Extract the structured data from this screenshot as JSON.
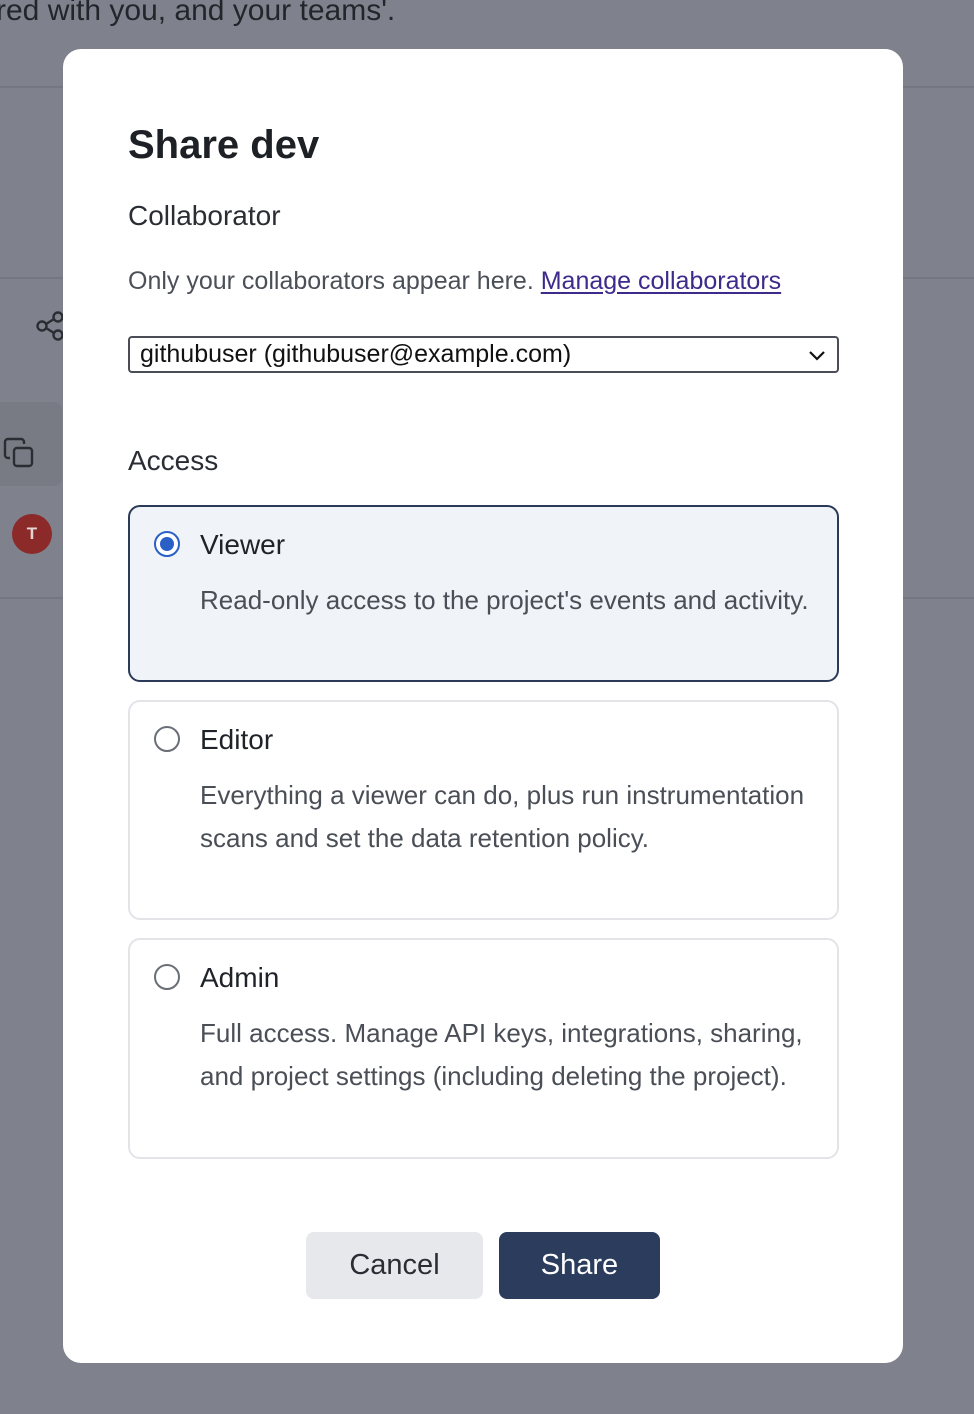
{
  "background": {
    "text": "red with you, and your teams'.",
    "avatar_initial": "T"
  },
  "modal": {
    "title": "Share dev",
    "collaborator_label": "Collaborator",
    "help_text": "Only your collaborators appear here. ",
    "manage_link": "Manage collaborators",
    "select_value": "githubuser (githubuser@example.com)",
    "access_label": "Access",
    "options": [
      {
        "title": "Viewer",
        "description": "Read-only access to the project's events and activity.",
        "selected": true
      },
      {
        "title": "Editor",
        "description": "Everything a viewer can do, plus run instrumentation scans and set the data retention policy.",
        "selected": false
      },
      {
        "title": "Admin",
        "description": "Full access. Manage API keys, integrations, sharing, and project settings (including deleting the project).",
        "selected": false
      }
    ],
    "cancel_label": "Cancel",
    "share_label": "Share"
  },
  "colors": {
    "overlay": "#7f828c",
    "primary": "#2b3c5c",
    "radio_selected": "#2a5fc7",
    "link": "#3d2a8a"
  }
}
